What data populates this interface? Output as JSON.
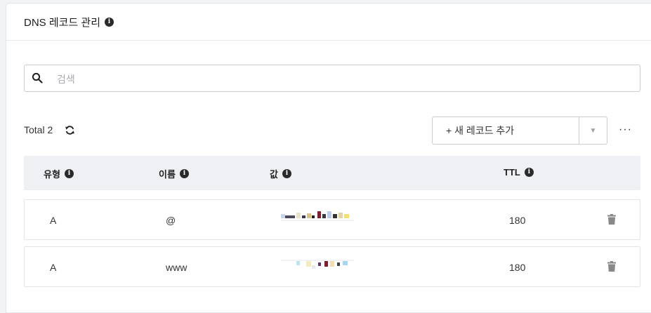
{
  "header": {
    "title": "DNS 레코드 관리"
  },
  "search": {
    "placeholder": "검색",
    "value": ""
  },
  "toolbar": {
    "total_label": "Total 2",
    "add_record_label": "+ 새 레코드 추가",
    "more_label": "···"
  },
  "table": {
    "columns": [
      "유형",
      "이름",
      "값",
      "TTL"
    ],
    "rows": [
      {
        "type": "A",
        "name": "@",
        "value": "",
        "ttl": "180"
      },
      {
        "type": "A",
        "name": "www",
        "value": "",
        "ttl": "180"
      }
    ]
  },
  "icons": {
    "info": "info-icon",
    "search": "search-icon",
    "refresh": "refresh-icon",
    "delete": "trash-icon",
    "dropdown": "caret-down-icon"
  },
  "colors": {
    "header_bg": "#eef0f3",
    "trash": "#888888"
  }
}
